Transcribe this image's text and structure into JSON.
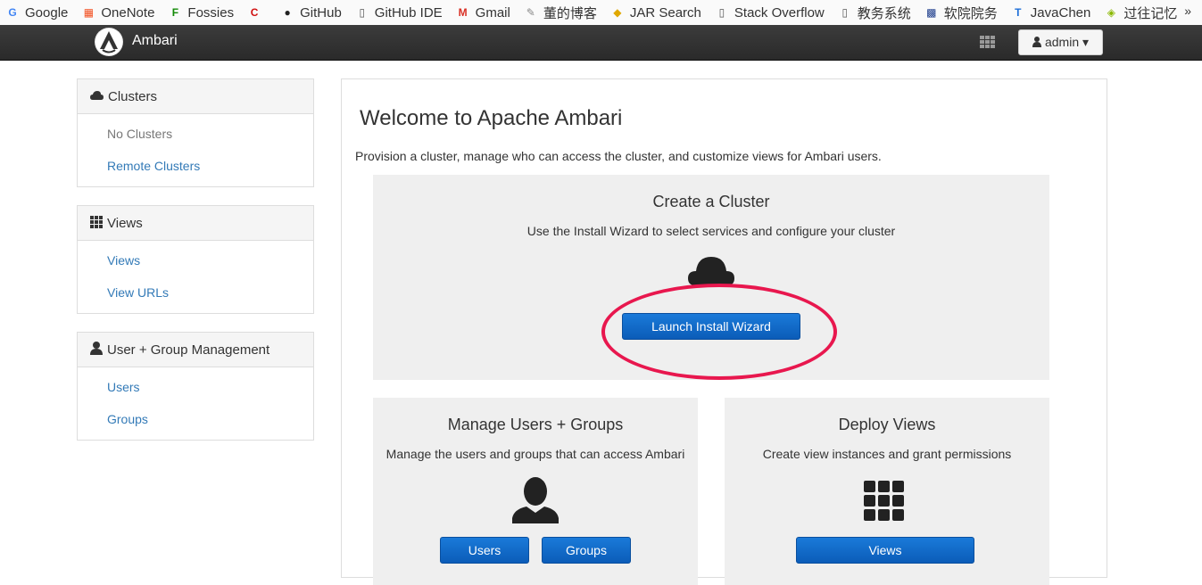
{
  "bookmarks": [
    {
      "label": "Google",
      "icon": "google-icon",
      "glyph": "G",
      "color": "#4285f4"
    },
    {
      "label": "OneNote",
      "icon": "windows-icon",
      "glyph": "▦",
      "color": "#f25022"
    },
    {
      "label": "Fossies",
      "icon": "fossies-icon",
      "glyph": "F",
      "color": "#138a07"
    },
    {
      "label": "",
      "icon": "c-red-icon",
      "glyph": "C",
      "color": "#d01010"
    },
    {
      "label": "GitHub",
      "icon": "github-icon",
      "glyph": "●",
      "color": "#222"
    },
    {
      "label": "GitHub IDE",
      "icon": "page-icon",
      "glyph": "▯",
      "color": "#555"
    },
    {
      "label": "Gmail",
      "icon": "gmail-icon",
      "glyph": "M",
      "color": "#d93025"
    },
    {
      "label": "董的博客",
      "icon": "feather-icon",
      "glyph": "✎",
      "color": "#888"
    },
    {
      "label": "JAR Search",
      "icon": "jar-icon",
      "glyph": "◆",
      "color": "#e0a800"
    },
    {
      "label": "Stack Overflow",
      "icon": "page-icon",
      "glyph": "▯",
      "color": "#555"
    },
    {
      "label": "教务系统",
      "icon": "page-icon",
      "glyph": "▯",
      "color": "#555"
    },
    {
      "label": "软院院务",
      "icon": "school-icon",
      "glyph": "▩",
      "color": "#1a3a8a"
    },
    {
      "label": "JavaChen",
      "icon": "t-icon",
      "glyph": "T",
      "color": "#1e6fd9"
    },
    {
      "label": "过往记忆",
      "icon": "memory-icon",
      "glyph": "◈",
      "color": "#8ab800"
    }
  ],
  "bookmarks_overflow": "»",
  "navbar": {
    "brand": "Ambari",
    "user": "admin ▾"
  },
  "sidebar": {
    "clusters": {
      "title": "Clusters",
      "items": [
        "No Clusters",
        "Remote Clusters"
      ]
    },
    "views": {
      "title": "Views",
      "items": [
        "Views",
        "View URLs"
      ]
    },
    "users": {
      "title": "User + Group Management",
      "items": [
        "Users",
        "Groups"
      ]
    }
  },
  "main": {
    "title": "Welcome to Apache Ambari",
    "description": "Provision a cluster, manage who can access the cluster, and customize views for Ambari users.",
    "create": {
      "title": "Create a Cluster",
      "text": "Use the Install Wizard to select services and configure your cluster",
      "button": "Launch Install Wizard"
    },
    "manage": {
      "title": "Manage Users + Groups",
      "text": "Manage the users and groups that can access Ambari",
      "btn_users": "Users",
      "btn_groups": "Groups"
    },
    "deploy": {
      "title": "Deploy Views",
      "text": "Create view instances and grant permissions",
      "button": "Views"
    }
  },
  "colors": {
    "link": "#337ab7",
    "button": "#0b5cb8",
    "highlight": "#e8174e"
  }
}
